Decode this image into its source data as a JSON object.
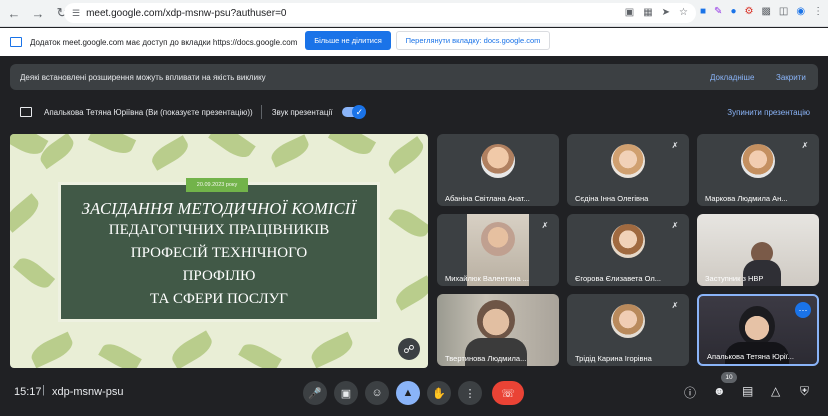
{
  "browser": {
    "url": "meet.google.com/xdp-msnw-psu?authuser=0"
  },
  "infobar": {
    "message": "Додаток meet.google.com має доступ до вкладки https://docs.google.com",
    "stop_sharing": "Більше не ділитися",
    "view_tab": "Переглянути вкладку: docs.google.com"
  },
  "warning": {
    "message": "Деякі встановлені розширення можуть впливати на якість виклику",
    "details": "Докладніше",
    "close": "Закрити"
  },
  "presenting": {
    "presenter": "Апалькова Тетяна Юріївна (Ви (показуєте презентацію))",
    "sound_label": "Звук презентації",
    "stop_label": "Зупинити презентацію"
  },
  "slide": {
    "date": "20.09.2023 року",
    "title_line": "ЗАСІДАННЯ МЕТОДИЧНОЇ КОМІСІЇ",
    "line2": "ПЕДАГОГІЧНИХ ПРАЦІВНИКІВ",
    "line3": "ПРОФЕСІЙ ТЕХНІЧНОГО",
    "line4": "ПРОФІЛЮ",
    "line5": "ТА СФЕРИ ПОСЛУГ"
  },
  "participants": [
    {
      "name": "Абаніна Світлана Анат...",
      "muted": false
    },
    {
      "name": "Сєдіна Інна Олегівна",
      "muted": true
    },
    {
      "name": "Маркова Людмила Ан...",
      "muted": true
    },
    {
      "name": "Михайлюк Валентина ...",
      "muted": true
    },
    {
      "name": "Єгорова Єлизавета Ол...",
      "muted": true
    },
    {
      "name": "Заступник з НВР",
      "muted": false
    },
    {
      "name": "Твертинова Людмила...",
      "muted": false
    },
    {
      "name": "Трідід Карина Ігорівна",
      "muted": true
    },
    {
      "name": "Апалькова Тетяна Юрії...",
      "muted": false
    }
  ],
  "bottom": {
    "time": "15:17",
    "separator": "|",
    "meeting_code": "xdp-msnw-psu",
    "people_count": "10"
  },
  "colors": {
    "accent": "#1a73e8",
    "end_call": "#ea4335",
    "background": "#202124"
  }
}
